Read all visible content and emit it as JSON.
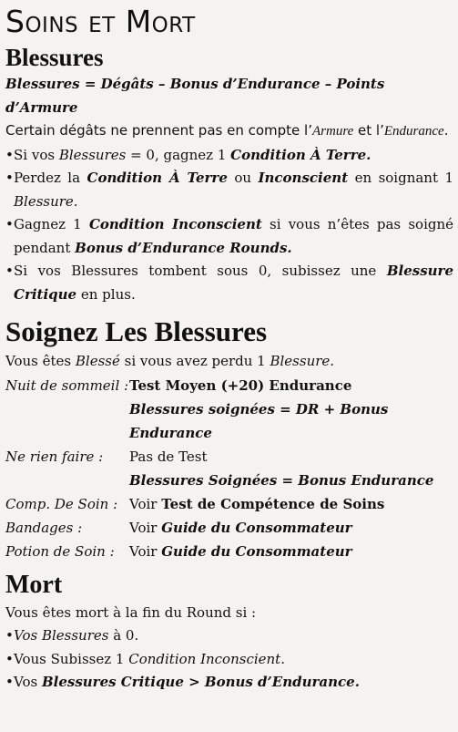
{
  "title": "Soins et Mort",
  "section_blessures": {
    "heading": "Blessures",
    "formula": "Blessures = Dégâts – Bonus d’Endurance – Points d’Armure",
    "intro_1": "Certain dégâts ne prennent pas en compte l’",
    "intro_armure": "Armure",
    "intro_2": " et l’",
    "intro_endurance": "Endurance",
    "intro_3": ".",
    "b1_a": "Si vos ",
    "b1_b": "Blessures",
    "b1_c": " = 0, gagnez 1 ",
    "b1_d": "Condition À Terre.",
    "b2_a": "Perdez la ",
    "b2_b": "Condition À Terre",
    "b2_c": " ou ",
    "b2_d": "Inconscient",
    "b2_e": " en soignant 1 ",
    "b2_f": "Blessure.",
    "b3_a": "Gagnez 1 ",
    "b3_b": "Condition Inconscient",
    "b3_c": " si vous n’êtes pas soigné pendant ",
    "b3_d": "Bonus d’Endurance Rounds.",
    "b4_a": "Si vos Blessures tombent sous 0, subissez une ",
    "b4_b": "Blessure Critique",
    "b4_c": " en plus."
  },
  "section_soins": {
    "heading": "Soignez Les Blessures",
    "intro_a": "Vous êtes ",
    "intro_b": "Blessé",
    "intro_c": " si vous avez perdu 1 ",
    "intro_d": "Blessure.",
    "row1_label": "Nuit de sommeil :",
    "row1_value": "Test Moyen (+20) Endurance",
    "row1_sub": "Blessures soignées = DR + Bonus Endurance",
    "row2_label": "Ne rien faire :",
    "row2_value": "Pas de Test",
    "row2_sub": "Blessures Soignées = Bonus Endurance",
    "row3_label": "Comp. De Soin :",
    "row3_a": "Voir ",
    "row3_b": "Test de Compétence de Soins",
    "row4_label": "Bandages :",
    "row4_a": "Voir ",
    "row4_b": "Guide du Consommateur",
    "row5_label": "Potion de Soin :",
    "row5_a": "Voir ",
    "row5_b": "Guide du Consommateur"
  },
  "section_mort": {
    "heading": "Mort",
    "intro": "Vous êtes mort à la fin du Round si :",
    "m1_a": "Vos Blessures",
    "m1_b": " à 0.",
    "m2_a": "Vous Subissez 1 ",
    "m2_b": "Condition Inconscient",
    "m2_c": ".",
    "m3_a": "Vos ",
    "m3_b": "Blessures Critique > Bonus d’Endurance."
  }
}
